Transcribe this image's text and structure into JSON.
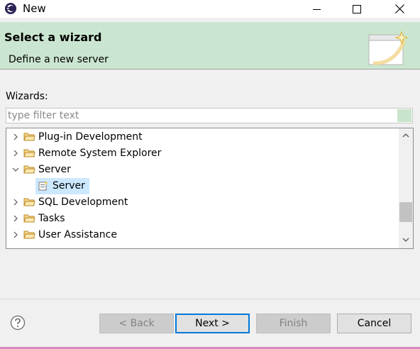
{
  "window": {
    "title": "New"
  },
  "banner": {
    "title": "Select a wizard",
    "subtitle": "Define a new server"
  },
  "wizards_label": "Wizards:",
  "filter": {
    "placeholder": "type filter text",
    "value": ""
  },
  "tree": {
    "items": [
      {
        "label": "Plug-in Development",
        "expanded": false,
        "icon": "folder-icon"
      },
      {
        "label": "Remote System Explorer",
        "expanded": false,
        "icon": "folder-icon"
      },
      {
        "label": "Server",
        "expanded": true,
        "icon": "folder-icon"
      },
      {
        "label": "Server",
        "child": true,
        "selected": true,
        "icon": "server-wizard-icon"
      },
      {
        "label": "SQL Development",
        "expanded": false,
        "icon": "folder-icon"
      },
      {
        "label": "Tasks",
        "expanded": false,
        "icon": "folder-icon"
      },
      {
        "label": "User Assistance",
        "expanded": false,
        "icon": "folder-icon"
      }
    ]
  },
  "buttons": {
    "back": "< Back",
    "next": "Next >",
    "finish": "Finish",
    "cancel": "Cancel"
  },
  "colors": {
    "banner_bg": "#cbe6d0",
    "selection": "#cce8ff",
    "default_button_border": "#0078d7"
  }
}
